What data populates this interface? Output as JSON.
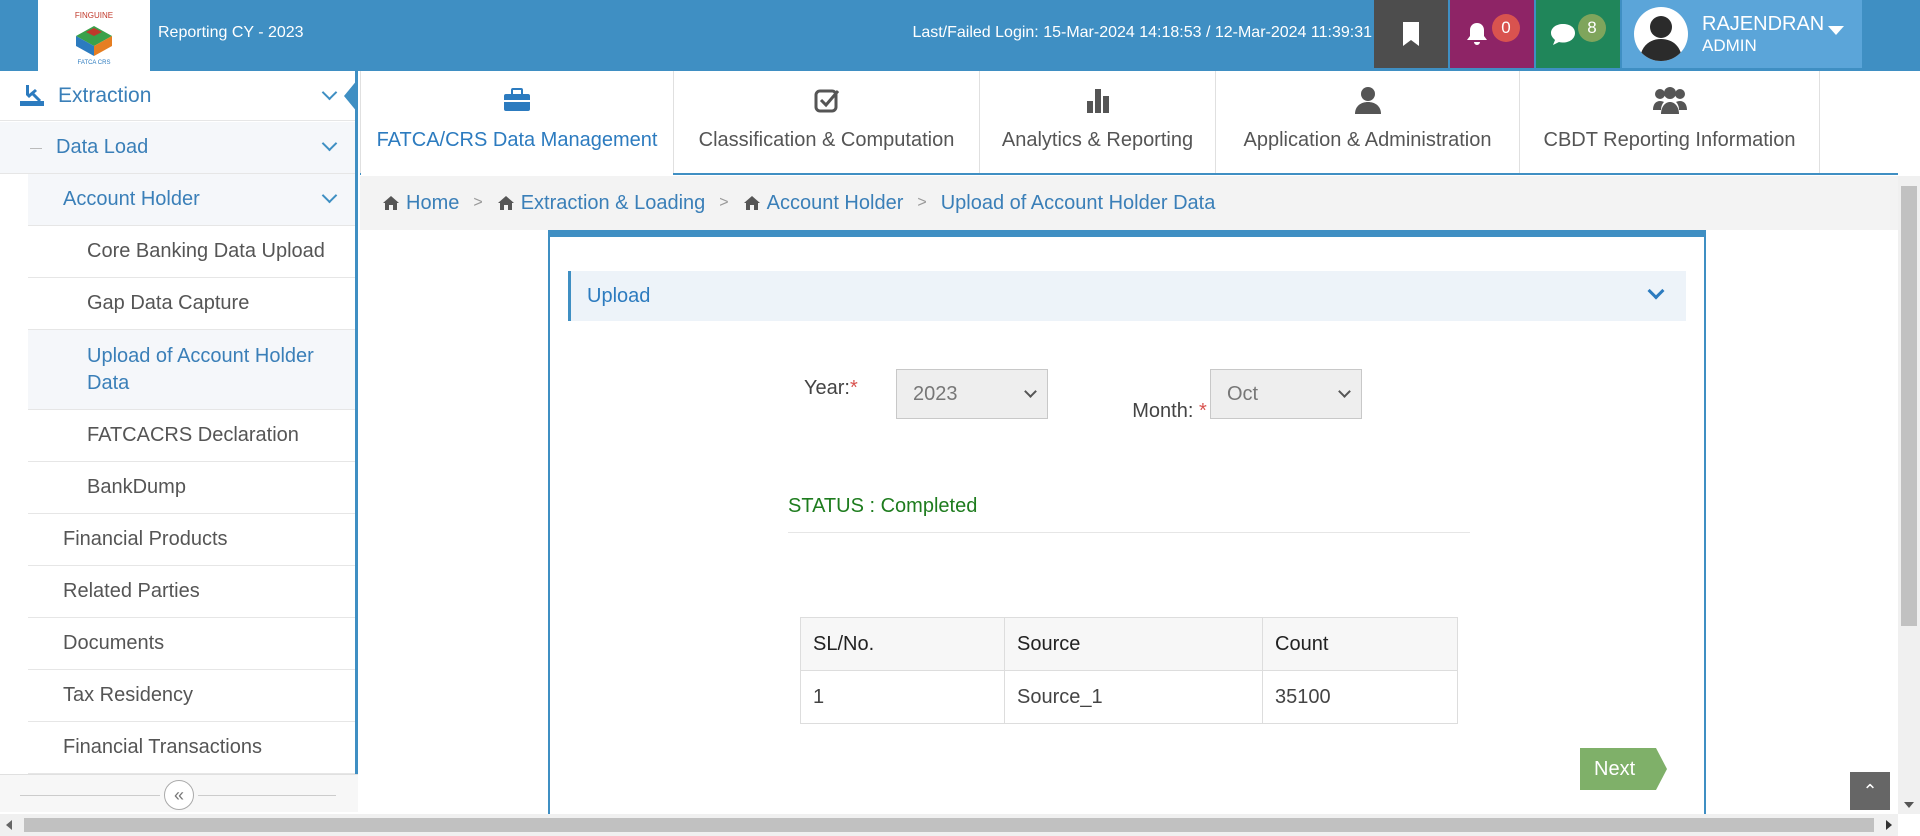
{
  "header": {
    "logo_text": "FINGUINE FATCA CRS",
    "reporting_cy": "Reporting CY - 2023",
    "login_info": "Last/Failed Login: 15-Mar-2024 14:18:53 / 12-Mar-2024 11:39:31",
    "notifications_count": "0",
    "messages_count": "8",
    "user_name": "RAJENDRAN",
    "user_role": "ADMIN",
    "colors": {
      "bar": "#3f8fc3",
      "bookmark": "#4d4d4d",
      "bell": "#8e2466",
      "chat": "#20865a",
      "user": "#5ba5d9"
    }
  },
  "sidebar": {
    "extraction": "Extraction",
    "data_load": "Data Load",
    "account_holder": "Account Holder",
    "sub_items": [
      "Core Banking Data Upload",
      "Gap Data Capture",
      "Upload of Account Holder Data",
      "FATCACRS Declaration",
      "BankDump"
    ],
    "active_sub_item": "Upload of Account Holder Data",
    "level2_items": [
      "Financial Products",
      "Related Parties",
      "Documents",
      "Tax Residency",
      "Financial Transactions"
    ],
    "collapse_icon": "double-chevron-left-icon"
  },
  "tabs": [
    {
      "label": "FATCA/CRS Data Management",
      "icon": "briefcase-icon",
      "active": true
    },
    {
      "label": "Classification & Computation",
      "icon": "check-square-icon",
      "active": false
    },
    {
      "label": "Analytics & Reporting",
      "icon": "bar-chart-icon",
      "active": false
    },
    {
      "label": "Application & Administration",
      "icon": "user-icon",
      "active": false
    },
    {
      "label": "CBDT Reporting Information",
      "icon": "users-icon",
      "active": false
    }
  ],
  "breadcrumb": {
    "items": [
      "Home",
      "Extraction & Loading",
      "Account Holder",
      "Upload of Account Holder Data"
    ]
  },
  "upload": {
    "section_title": "Upload",
    "year_label": "Year:",
    "year_value": "2023",
    "month_label": "Month: ",
    "month_value": "Oct",
    "required_mark": "*",
    "status": "STATUS : Completed",
    "table": {
      "headers": [
        "SL/No.",
        "Source",
        "Count"
      ],
      "rows": [
        [
          "1",
          "Source_1",
          "35100"
        ]
      ]
    },
    "next_label": "Next"
  }
}
